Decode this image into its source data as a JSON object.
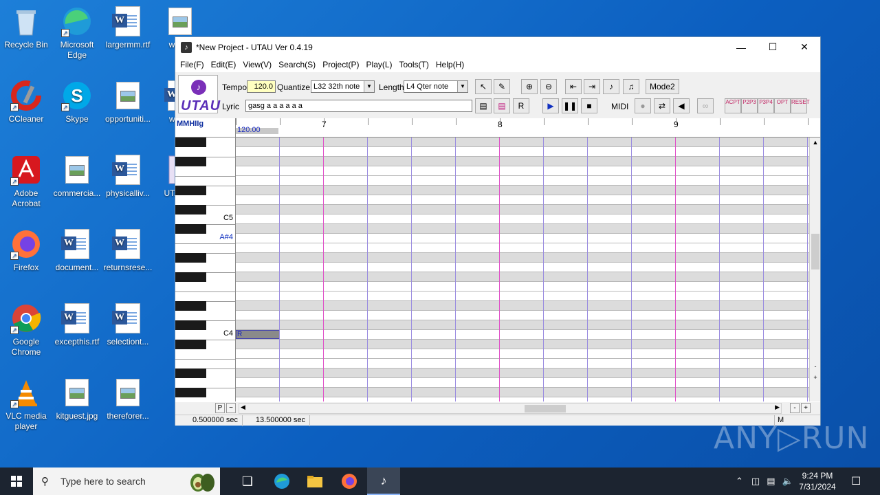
{
  "desktop": {
    "icons": [
      {
        "label": "Recycle Bin",
        "type": "recycle"
      },
      {
        "label": "Microsoft Edge",
        "type": "edge"
      },
      {
        "label": "largermm.rtf",
        "type": "word"
      },
      {
        "label": "warr...",
        "type": "image"
      },
      {
        "label": "CCleaner",
        "type": "ccleaner"
      },
      {
        "label": "Skype",
        "type": "skype"
      },
      {
        "label": "opportuniti...",
        "type": "image"
      },
      {
        "label": "wee...",
        "type": "word"
      },
      {
        "label": "Adobe Acrobat",
        "type": "acrobat"
      },
      {
        "label": "commercia...",
        "type": "image"
      },
      {
        "label": "physicalliv...",
        "type": "word"
      },
      {
        "label": "UTA合成",
        "type": "utau"
      },
      {
        "label": "Firefox",
        "type": "firefox"
      },
      {
        "label": "document...",
        "type": "word"
      },
      {
        "label": "returnsrese...",
        "type": "word"
      },
      {
        "label": "Google Chrome",
        "type": "chrome"
      },
      {
        "label": "excepthis.rtf",
        "type": "word"
      },
      {
        "label": "selectiont...",
        "type": "word"
      },
      {
        "label": "VLC media player",
        "type": "vlc"
      },
      {
        "label": "kitguest.jpg",
        "type": "image"
      },
      {
        "label": "thereforer...",
        "type": "image"
      }
    ]
  },
  "window": {
    "title": "*New Project - UTAU Ver 0.4.19",
    "controls": {
      "minimize": "—",
      "maximize": "☐",
      "close": "✕"
    },
    "menu": [
      "File(F)",
      "Edit(E)",
      "View(V)",
      "Search(S)",
      "Project(P)",
      "Play(L)",
      "Tools(T)",
      "Help(H)"
    ]
  },
  "toolbar": {
    "logo_text": "UTAU",
    "tempo_label": "Tempo",
    "tempo_value": "120.0",
    "quantize_label": "Quantize",
    "quantize_value": "L32 32th note",
    "length_label": "Length",
    "length_value": "L4  Qter note",
    "lyric_label": "Lyric",
    "lyric_value": "gasg  a a a                    a a a",
    "mode_button": "Mode2",
    "midi_label": "MIDI",
    "effect_buttons": [
      "ACPT",
      "P2P3",
      "P3P4",
      "OPT",
      "RESET"
    ]
  },
  "piano_roll": {
    "corner_label": "MMHIIg",
    "ruler_measures": [
      "7",
      "8",
      "9"
    ],
    "tempo_marker": "120.00",
    "key_labels": {
      "c5": "C5",
      "as4": "A#4",
      "c4": "C4"
    },
    "note": {
      "lyric": "R"
    },
    "bottom_left_buttons": [
      "P",
      "~"
    ]
  },
  "statusbar": {
    "time1": "0.500000 sec",
    "time2": "13.500000 sec",
    "mode": "M"
  },
  "taskbar": {
    "search_placeholder": "Type here to search",
    "time": "9:24 PM",
    "date": "7/31/2024"
  },
  "watermark": "ANY▷RUN"
}
